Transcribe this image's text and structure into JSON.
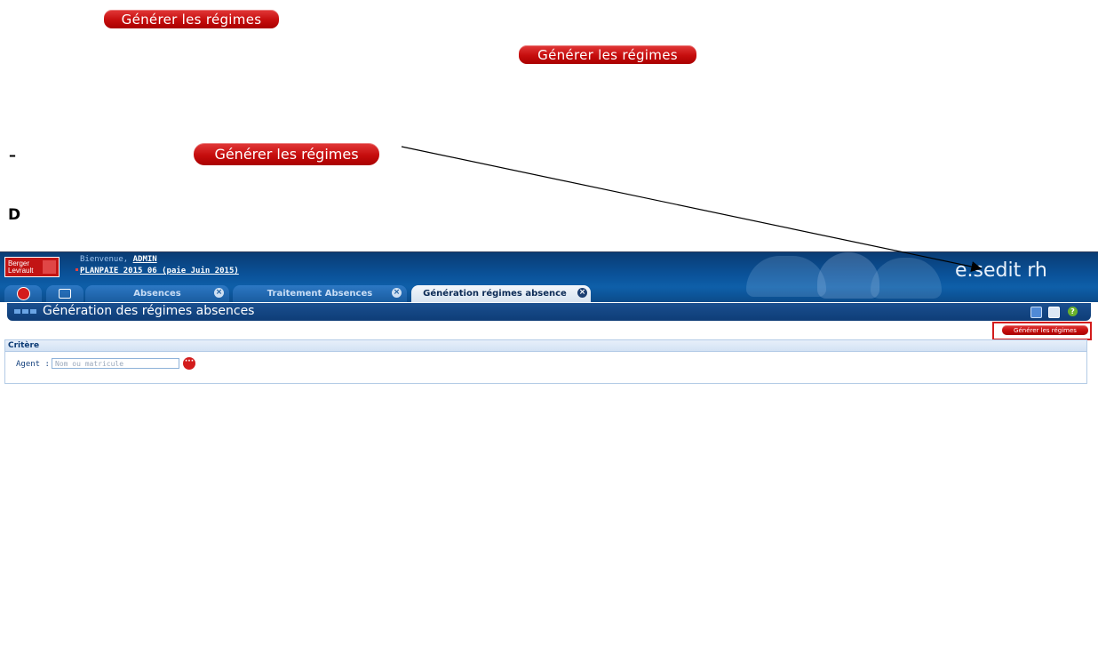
{
  "annotations": {
    "button_label": "Générer les régimes",
    "dash": "–",
    "letter": "D"
  },
  "app": {
    "logo": "Berger Levrault",
    "welcome_prefix": "Bienvenue,",
    "user": "ADMIN",
    "planpaie": "PLANPAIE 2015_06 (paie Juin 2015)",
    "brand": "e.sedit rh",
    "tabs": [
      {
        "label": "",
        "icon": "home-icon"
      },
      {
        "label": "",
        "icon": "menu-icon"
      },
      {
        "label": "Absences"
      },
      {
        "label": "Traitement Absences"
      },
      {
        "label": "Génération régimes absence",
        "active": true
      }
    ],
    "page_title": "Génération des régimes absences",
    "toolbar_icons": [
      "export-icon",
      "print-icon",
      "help-icon"
    ],
    "action_button": "Générer les régimes",
    "criteria": {
      "header": "Critère",
      "agent_label": "Agent :",
      "agent_placeholder": "Nom ou matricule"
    }
  },
  "colors": {
    "button_red": "#c60d0d",
    "header_blue": "#0a5299",
    "highlight": "#d31c1c"
  }
}
